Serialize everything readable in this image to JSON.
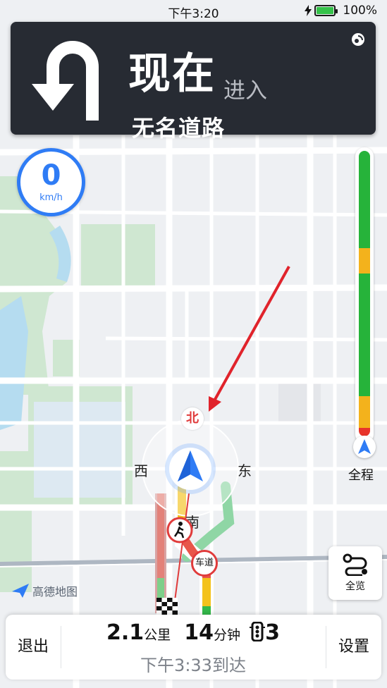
{
  "status_bar": {
    "time": "下午3:20",
    "battery": "100%"
  },
  "navigation": {
    "turn_icon": "u-turn-arrow-icon",
    "distance": "现在",
    "action": "进入",
    "road_name": "无名道路"
  },
  "speed": {
    "value": "0",
    "unit": "km/h"
  },
  "compass": {
    "north": "北",
    "south": "南",
    "east": "东",
    "west": "西"
  },
  "map_labels": {
    "pedestrian_badge": "pedestrian-crossing-icon",
    "lane_badge": "车道"
  },
  "traffic_bar": {
    "label": "全程",
    "colors": {
      "smooth": "#26b33a",
      "slow": "#f3b21c",
      "congested": "#e8342b"
    },
    "segments": [
      {
        "status": "smooth",
        "fraction": 0.34
      },
      {
        "status": "slow",
        "fraction": 0.09
      },
      {
        "status": "smooth",
        "fraction": 0.11
      },
      {
        "status": "smooth",
        "fraction": 0.32
      },
      {
        "status": "slow",
        "fraction": 0.11
      },
      {
        "status": "congested",
        "fraction": 0.03
      }
    ]
  },
  "overview_button": {
    "label": "全览"
  },
  "logo": {
    "text": "高德地图"
  },
  "bottom_bar": {
    "exit_label": "退出",
    "distance_value": "2.1",
    "distance_unit": "公里",
    "time_value": "14",
    "time_unit": "分钟",
    "traffic_lights": "3",
    "arrival": "下午3:33到达",
    "settings_label": "设置"
  }
}
